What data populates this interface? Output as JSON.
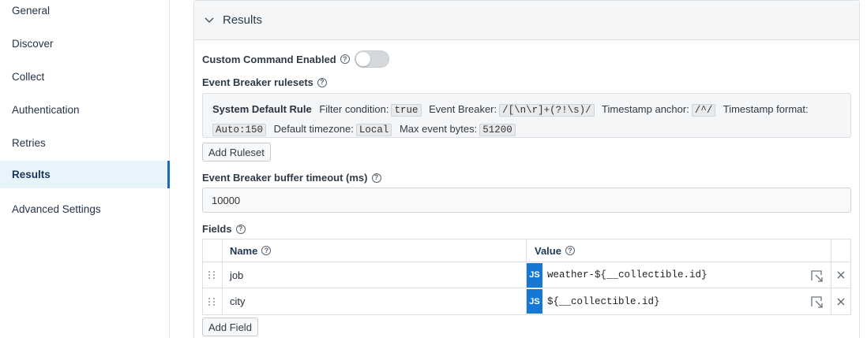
{
  "sidebar": {
    "items": [
      {
        "label": "General"
      },
      {
        "label": "Discover"
      },
      {
        "label": "Collect"
      },
      {
        "label": "Authentication"
      },
      {
        "label": "Retries"
      },
      {
        "label": "Results"
      },
      {
        "label": "Advanced Settings"
      }
    ],
    "active": "Results"
  },
  "panel": {
    "title": "Results",
    "custom_command_label": "Custom Command Enabled",
    "custom_command_enabled": false,
    "event_breaker_label": "Event Breaker rulesets",
    "ruleset": {
      "name": "System Default Rule",
      "filter_label": "Filter condition:",
      "filter_value": "true",
      "breaker_label": "Event Breaker:",
      "breaker_value": "/[\\n\\r]+(?!\\s)/",
      "ts_anchor_label": "Timestamp anchor:",
      "ts_anchor_value": "/^/",
      "ts_format_label": "Timestamp format:",
      "ts_format_value": "Auto:150",
      "tz_label": "Default timezone:",
      "tz_value": "Local",
      "max_bytes_label": "Max event bytes:",
      "max_bytes_value": "51200"
    },
    "add_ruleset_label": "Add Ruleset",
    "buffer_timeout_label": "Event Breaker buffer timeout (ms)",
    "buffer_timeout_value": "10000",
    "fields_label": "Fields",
    "fields_table": {
      "name_header": "Name",
      "value_header": "Value",
      "js_badge": "JS",
      "rows": [
        {
          "name": "job",
          "value": "weather-${__collectible.id}"
        },
        {
          "name": "city",
          "value": "${__collectible.id}"
        }
      ]
    },
    "add_field_label": "Add Field"
  },
  "colors": {
    "accent": "#1b6bb0",
    "active_bg": "#e8f4fc",
    "js_badge": "#1478d4"
  },
  "icons": [
    "chevron-down-icon",
    "help-icon",
    "drag-handle-icon",
    "expand-icon",
    "close-icon"
  ]
}
